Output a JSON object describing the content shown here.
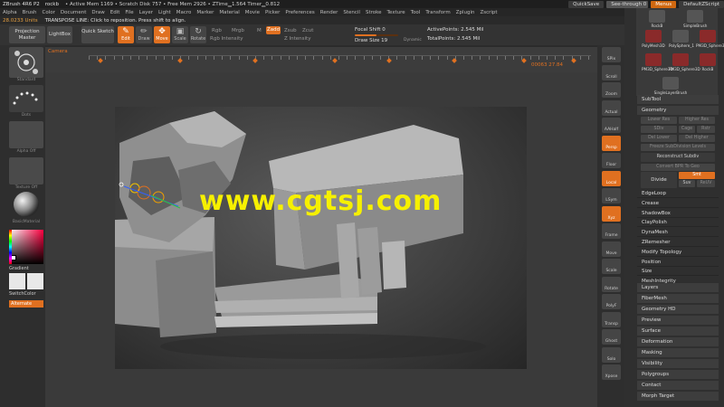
{
  "titlebar": {
    "app": "ZBrush 4R6 P2",
    "doc": "rockb",
    "status": "• Active Mem 1169 • Scratch Disk 757 • Free Mem 2926 • ZTime▁1.564 Timer▁0.812",
    "quicksave": "QuickSave",
    "seethrough": "See-through 0",
    "menus": "Menus",
    "default_script": "DefaultZScript"
  },
  "menubar": [
    "Alpha",
    "Brush",
    "Color",
    "Document",
    "Draw",
    "Edit",
    "File",
    "Layer",
    "Light",
    "Macro",
    "Marker",
    "Material",
    "Movie",
    "Picker",
    "Preferences",
    "Render",
    "Stencil",
    "Stroke",
    "Texture",
    "Tool",
    "Transform",
    "Zplugin",
    "Zscript"
  ],
  "info": {
    "units": "28.0233 Units",
    "hint": "TRANSPOSE LINE: Click to reposition. Press shift to align."
  },
  "toolbar": {
    "projection_master": "Projection Master",
    "lightbox": "LightBox",
    "quick_sketch": "Quick Sketch",
    "edit": "Edit",
    "draw": "Draw",
    "move": "Move",
    "scale": "Scale",
    "rotate": "Rotate",
    "rgb": "Rgb",
    "mrgb": "Mrgb",
    "rgb_intensity": "Rgb Intensity",
    "m": "M",
    "zadd": "Zadd",
    "zsub": "Zsub",
    "zcut": "Zcut",
    "z_intensity": "Z Intensity",
    "focal_shift": "Focal Shift 0",
    "draw_size": "Draw Size 19",
    "dynamic": "Dynamic",
    "active_points": "ActivePoints: 2.545 Mil",
    "total_points": "TotalPoints: 2.545 Mil"
  },
  "timeline": {
    "camera": "Camera",
    "time": "00063  27.84"
  },
  "leftshelf": {
    "standard": "Standard",
    "dots": "Dots",
    "alpha_off": "Alpha Off",
    "texture_off": "Texture Off",
    "basic_material": "BasicMaterial",
    "gradient": "Gradient",
    "switch_color": "SwitchColor",
    "alternate": "Alternate"
  },
  "watermark": "www.cgtsj.com",
  "rightstrip": [
    "SPix",
    "Scroll",
    "Zoom",
    "Actual",
    "AAHalf",
    "Persp",
    "Floor",
    "Local",
    "LSym",
    "Xyz",
    "Frame",
    "Move",
    "Scale",
    "Rotate",
    "PolyF",
    "Transp",
    "Ghost",
    "Solo",
    "Xpose"
  ],
  "rightpanel": {
    "tools": [
      {
        "name": "RockB",
        "num": ""
      },
      {
        "name": "SimpleBrush",
        "num": ""
      },
      {
        "name": "PolyMesh3D",
        "num": "2"
      },
      {
        "name": "PolySphere_1",
        "num": "2"
      },
      {
        "name": "PM3D_Sphere3D",
        "num": ""
      },
      {
        "name": "PM3D_Sphere3D",
        "num": "2"
      },
      {
        "name": "PM3D_Sphere3D",
        "num": "4"
      },
      {
        "name": "RockB",
        "num": ""
      },
      {
        "name": "SingleLayerBrush",
        "num": ""
      }
    ],
    "subtool": "SubTool",
    "geometry": "Geometry",
    "lower_res": "Lower Res",
    "higher_res": "Higher Res",
    "sdiv": "SDiv",
    "cage": "Cage",
    "rstr": "Rstr",
    "del_lower": "Del Lower",
    "del_higher": "Del Higher",
    "freeze": "Freeze SubDivision Levels",
    "reconstruct": "Reconstruct Subdiv",
    "convert_bpr": "Convert BPR To Geo",
    "divide": "Divide",
    "smt": "Smt",
    "suv": "Suv",
    "reuv": "ReUV",
    "items_top": [
      "EdgeLoop",
      "Crease",
      "ShadowBox",
      "ClayPolish",
      "DynaMesh",
      "ZRemesher",
      "Modify Topology",
      "Position",
      "Size",
      "MeshIntegrity"
    ],
    "items_bottom": [
      "Layers",
      "FiberMesh",
      "Geometry HD",
      "Preview",
      "Surface",
      "Deformation",
      "Masking",
      "Visibility",
      "Polygroups",
      "Contact",
      "Morph Target"
    ]
  },
  "colors": {
    "accent": "#e07020",
    "watermark": "#f6f000",
    "panel": "#2f2f2f"
  }
}
